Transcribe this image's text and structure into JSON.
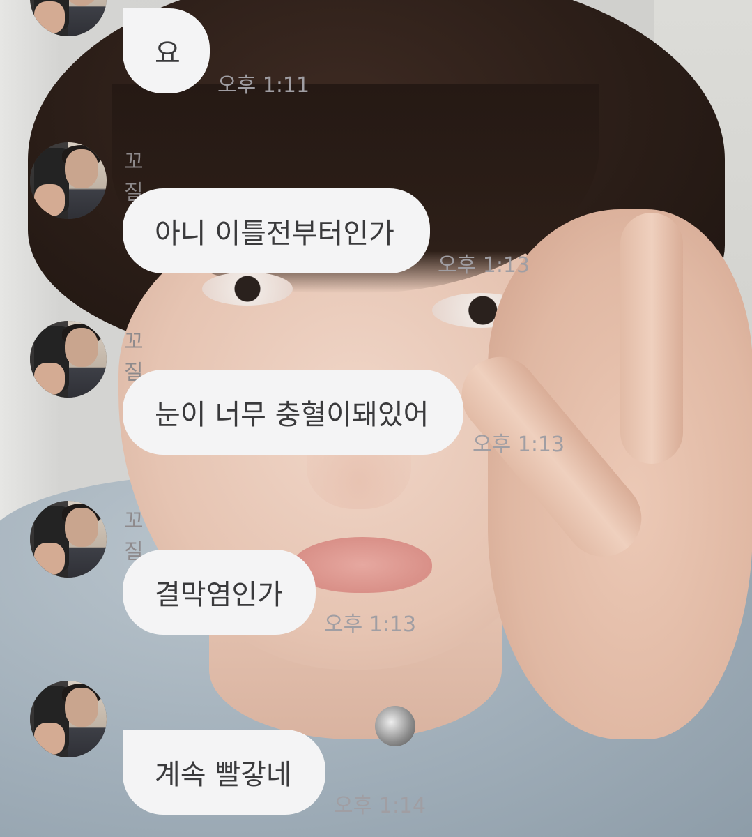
{
  "chat": {
    "messages": [
      {
        "sender": "",
        "text": "요",
        "time": "오후 1:11"
      },
      {
        "sender": "꼬질이",
        "text": "아니 이틀전부터인가",
        "time": "오후 1:13"
      },
      {
        "sender": "꼬질이",
        "text": "눈이 너무 충혈이돼있어",
        "time": "오후 1:13"
      },
      {
        "sender": "꼬질이",
        "text": "결막염인가",
        "time": "오후 1:13"
      },
      {
        "sender": "",
        "text": "계속 빨갛네",
        "time": "오후 1:14"
      }
    ]
  },
  "colors": {
    "bubble": "#f4f4f5",
    "bubble_text": "#3a3a3c",
    "name_text": "#8e8a8c",
    "time_text": "#a09ea3"
  }
}
